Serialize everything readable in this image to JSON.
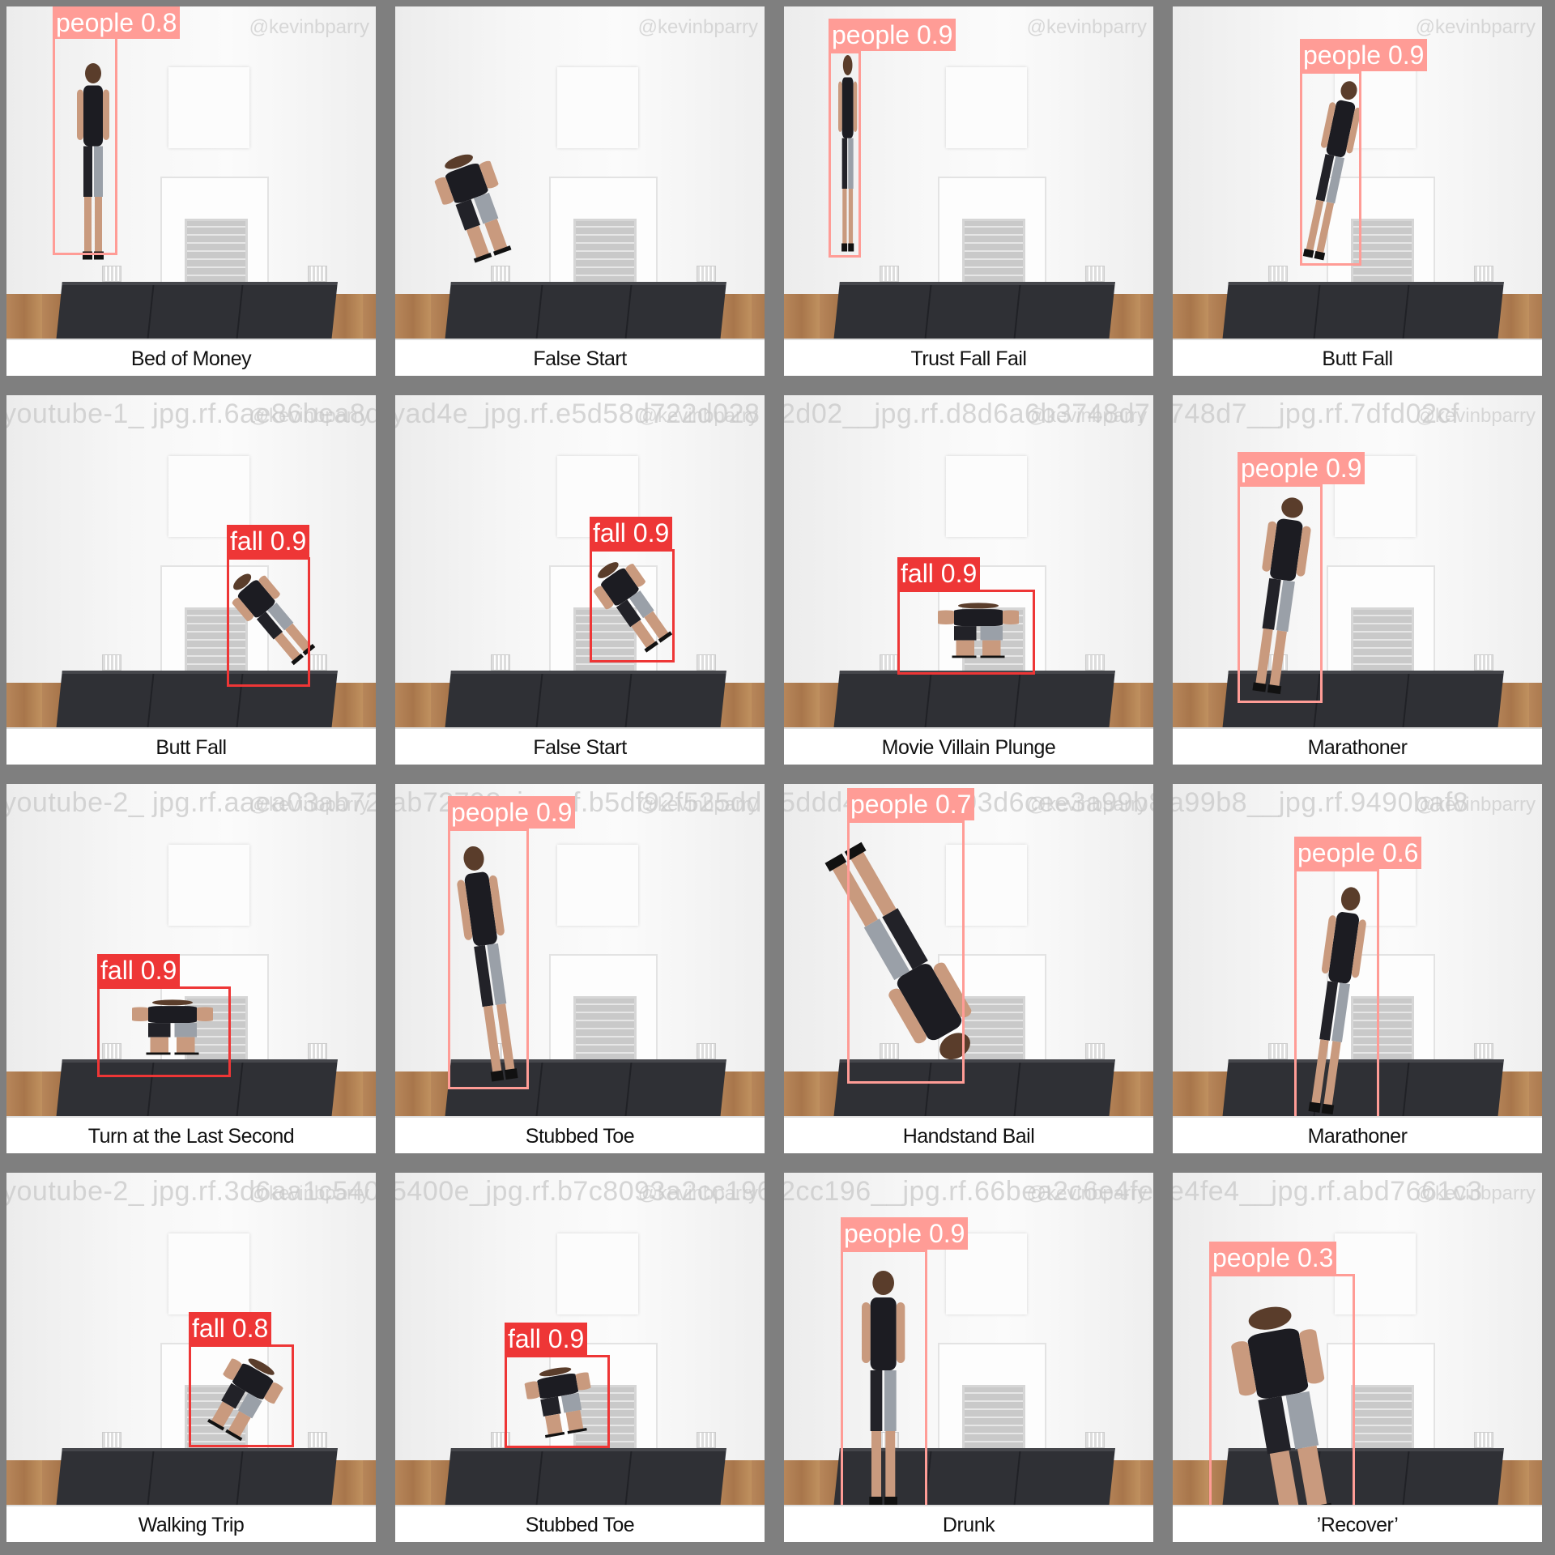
{
  "grid": {
    "columns": 4,
    "rows": 4
  },
  "colors": {
    "people_box": "#ff9c96",
    "fall_box": "#ee3636",
    "background": "#7f7f7f"
  },
  "watermark": "@kevinbparry",
  "tiles": [
    {
      "caption": "Bed of Money",
      "ghost": "",
      "detections": [
        {
          "cls": "people",
          "label": "people 0.8"
        }
      ]
    },
    {
      "caption": "False Start",
      "ghost": "",
      "detections": []
    },
    {
      "caption": "Trust Fall Fail",
      "ghost": "",
      "detections": [
        {
          "cls": "people",
          "label": "people 0.9"
        }
      ]
    },
    {
      "caption": "Butt Fall",
      "ghost": "",
      "detections": [
        {
          "cls": "people",
          "label": "people 0.9"
        }
      ]
    },
    {
      "caption": "Butt Fall",
      "ghost": "youtube-1_ jpg.rf.6ae86bea8d4e",
      "detections": [
        {
          "cls": "fall",
          "label": "fall 0.9"
        }
      ]
    },
    {
      "caption": "False Start",
      "ghost": "yad4e_jpg.rf.e5d58d722d028",
      "detections": [
        {
          "cls": "fall",
          "label": "fall 0.9"
        }
      ]
    },
    {
      "caption": "Movie Villain Plunge",
      "ghost": "2d02__jpg.rf.d8d6a6b3748d7",
      "detections": [
        {
          "cls": "fall",
          "label": "fall 0.9"
        }
      ]
    },
    {
      "caption": "Marathoner",
      "ghost": "748d7__jpg.rf.7dfd02cf",
      "detections": [
        {
          "cls": "people",
          "label": "people 0.9"
        }
      ]
    },
    {
      "caption": "Turn at the Last Second",
      "ghost": "youtube-2_ jpg.rf.aaea03ab72798",
      "detections": [
        {
          "cls": "fall",
          "label": "fall 0.9"
        }
      ]
    },
    {
      "caption": "Stubbed Toe",
      "ghost": "ab72798_jpg.rf.b5df92f525dd",
      "detections": [
        {
          "cls": "people",
          "label": "people 0.9"
        }
      ]
    },
    {
      "caption": "Handstand Bail",
      "ghost": "5ddd49_jpg.rf.93d6cee3a99b8",
      "detections": [
        {
          "cls": "people",
          "label": "people 0.7"
        }
      ]
    },
    {
      "caption": "Marathoner",
      "ghost": "a99b8__jpg.rf.9490baf8",
      "detections": [
        {
          "cls": "people",
          "label": "people 0.6"
        }
      ]
    },
    {
      "caption": "Walking Trip",
      "ghost": "youtube-2_ jpg.rf.3d6aa1c5400e",
      "detections": [
        {
          "cls": "fall",
          "label": "fall 0.8"
        }
      ]
    },
    {
      "caption": "Stubbed Toe",
      "ghost": "5400e_jpg.rf.b7c8093a2cc196",
      "detections": [
        {
          "cls": "fall",
          "label": "fall 0.9"
        }
      ]
    },
    {
      "caption": "Drunk",
      "ghost": "2cc196__jpg.rf.66bea2c6e4fe4",
      "detections": [
        {
          "cls": "people",
          "label": "people 0.9"
        }
      ]
    },
    {
      "caption": "’Recover’",
      "ghost": "e4fe4__jpg.rf.abd7661c3",
      "detections": [
        {
          "cls": "people",
          "label": "people 0.3"
        }
      ]
    }
  ]
}
